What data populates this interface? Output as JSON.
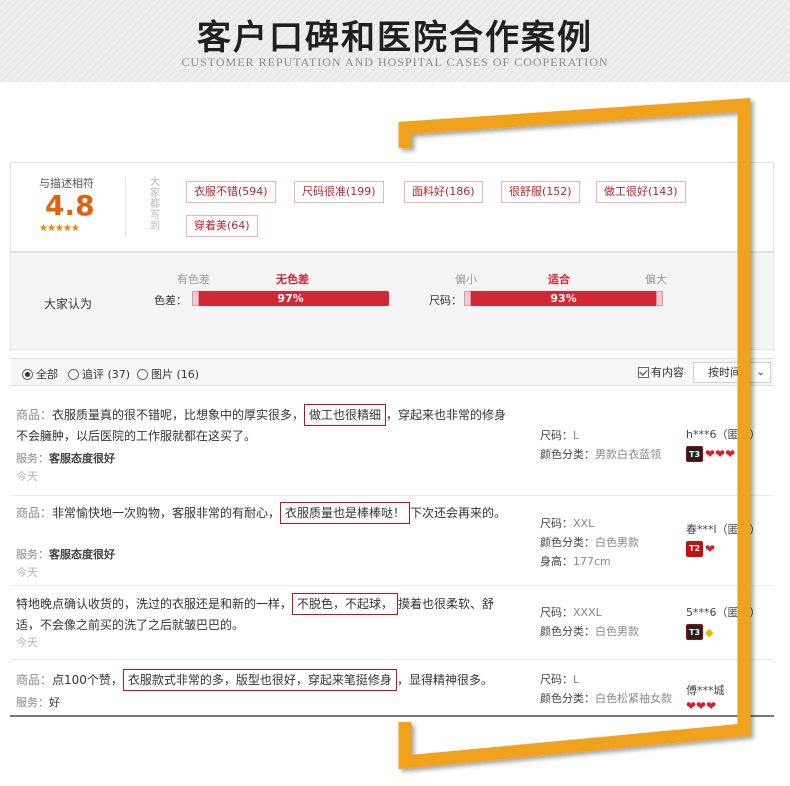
{
  "header": {
    "title": "客户口碑和医院合作案例",
    "subtitle": "CUSTOMER REPUTATION AND HOSPITAL CASES OF COOPERATION"
  },
  "summary": {
    "label": "与描述相符",
    "score": "4.8",
    "stars": "★★★★★",
    "vertical_label": "大家都写到",
    "tags": [
      "衣服不错(594)",
      "尺码很准(199)",
      "面料好(186)",
      "很舒服(152)",
      "做工很好(143)",
      "穿着美(64)"
    ]
  },
  "tendency": {
    "label": "大家认为",
    "color": {
      "name": "色差：",
      "scale": [
        "有色差",
        "无色差"
      ],
      "active": "无色差",
      "percent_text": "97%",
      "value": 0.97
    },
    "size": {
      "name": "尺码：",
      "scale": [
        "偏小",
        "适合",
        "偏大"
      ],
      "active": "适合",
      "percent_text": "93%",
      "value": 0.93
    }
  },
  "filter": {
    "options": [
      {
        "label": "全部",
        "selected": true
      },
      {
        "label": "追评 (37)",
        "selected": false
      },
      {
        "label": "图片 (16)",
        "selected": false
      }
    ],
    "has_content": "有内容",
    "sort": "按时间"
  },
  "reviews": [
    {
      "prefix": "商品：",
      "text_before": "衣服质量真的很不错呢，比想象中的厚实很多，",
      "highlight": "做工也很精细",
      "text_after": "，穿起来也非常的修身不会臃肿，以后医院的工作服就都在这买了。",
      "service_label": "服务：",
      "service": "客服态度很好",
      "date": "今天",
      "size_label": "尺码：",
      "size": "L",
      "color_label": "颜色分类：",
      "color": "男款白衣蓝领",
      "height_label": "",
      "height": "",
      "user": "h***6（匿名）",
      "level": "T3"
    },
    {
      "prefix": "商品：",
      "text_before": "非常愉快地一次购物，客服非常的有耐心，",
      "highlight": "衣服质量也是棒棒哒！",
      "text_after": "下次还会再来的。",
      "service_label": "服务：",
      "service": "客服态度很好",
      "date": "今天",
      "size_label": "尺码：",
      "size": "XXL",
      "color_label": "颜色分类：",
      "color": "白色男款",
      "height_label": "身高：",
      "height": "177cm",
      "user": "春***l（匿名）",
      "level": "T2"
    },
    {
      "prefix": "",
      "text_before": "特地晚点确认收货的，洗过的衣服还是和新的一样，",
      "highlight": "不脱色，不起球，",
      "text_after": "摸着也很柔软、舒适，不会像之前买的洗了之后就皱巴巴的。",
      "service_label": "",
      "service": "",
      "date": "今天",
      "size_label": "尺码：",
      "size": "XXXL",
      "color_label": "颜色分类：",
      "color": "白色男款",
      "height_label": "",
      "height": "",
      "user": "5***6（匿名）",
      "level": "T3"
    },
    {
      "prefix": "商品：",
      "text_before": "点100个赞，",
      "highlight": "衣服款式非常的多，版型也很好，穿起来笔挺修身",
      "text_after": "，显得精神很多。",
      "service_label": "服务：",
      "service": "好",
      "date": "",
      "size_label": "尺码：",
      "size": "L",
      "color_label": "颜色分类：",
      "color": "白色松紧袖女款",
      "height_label": "",
      "height": "",
      "user": "傅***城",
      "level": ""
    }
  ],
  "colors": {
    "frame": "#f0a21a",
    "bar": "#d42736",
    "score": "#e2610d",
    "highlight_border": "#c0111c"
  }
}
